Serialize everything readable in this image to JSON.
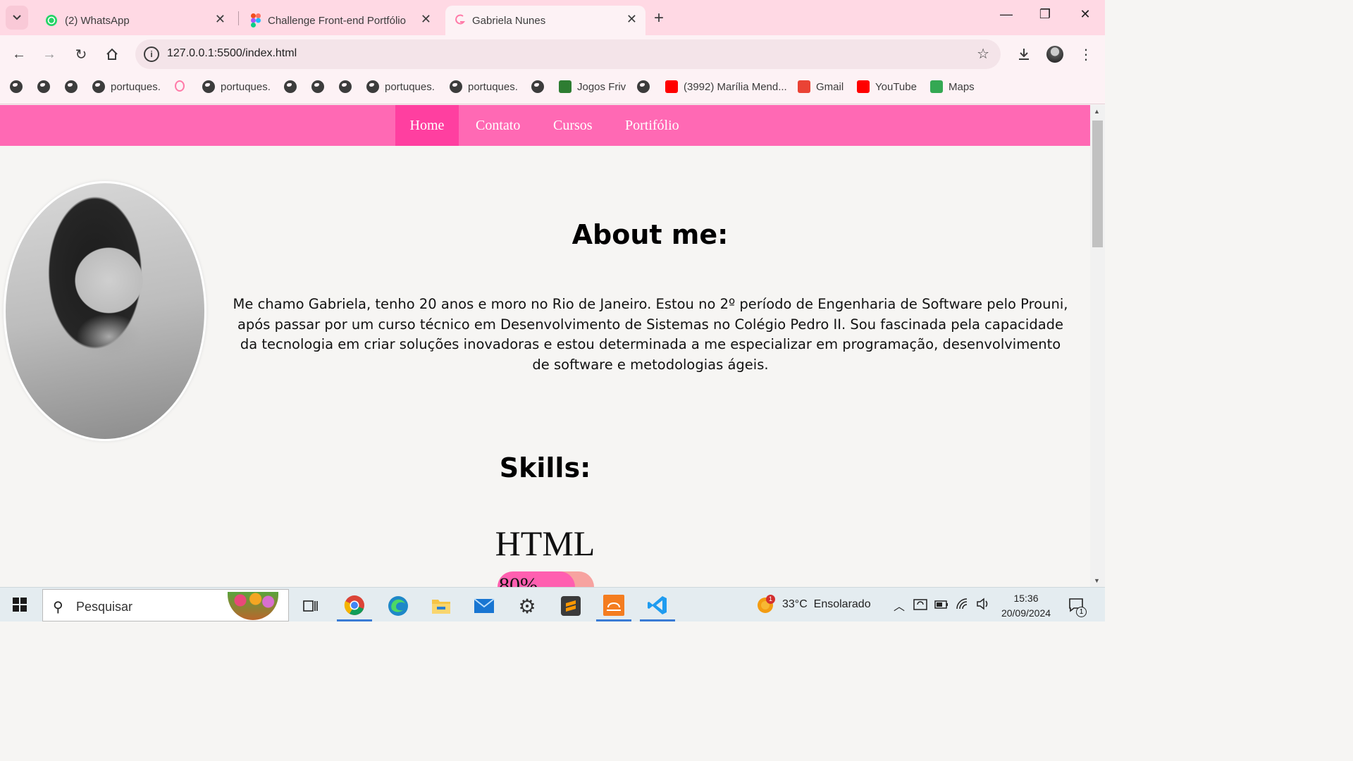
{
  "browser": {
    "tabs": [
      {
        "label": "(2) WhatsApp",
        "icon": "whatsapp-icon",
        "active": false
      },
      {
        "label": "Challenge Front-end Portfólio -",
        "icon": "figma-icon",
        "active": false
      },
      {
        "label": "Gabriela Nunes",
        "icon": "site-g-icon",
        "active": true
      }
    ],
    "address": "127.0.0.1:5500/index.html",
    "bookmarks": [
      {
        "label": "",
        "icon": "globe-icon"
      },
      {
        "label": "",
        "icon": "globe-icon"
      },
      {
        "label": "",
        "icon": "globe-icon"
      },
      {
        "label": "portuques.",
        "icon": "globe-icon"
      },
      {
        "label": "",
        "icon": "site-g-icon"
      },
      {
        "label": "portuques.",
        "icon": "globe-icon"
      },
      {
        "label": "",
        "icon": "globe-icon"
      },
      {
        "label": "",
        "icon": "globe-icon"
      },
      {
        "label": "",
        "icon": "globe-icon"
      },
      {
        "label": "portuques.",
        "icon": "globe-icon"
      },
      {
        "label": "portuques.",
        "icon": "globe-icon"
      },
      {
        "label": "",
        "icon": "globe-icon"
      },
      {
        "label": "Jogos Friv",
        "icon": "friv-icon"
      },
      {
        "label": "",
        "icon": "globe-icon"
      },
      {
        "label": "(3992) Marília Mend...",
        "icon": "youtube-icon"
      },
      {
        "label": "Gmail",
        "icon": "gmail-icon"
      },
      {
        "label": "YouTube",
        "icon": "youtube-icon"
      },
      {
        "label": "Maps",
        "icon": "maps-icon"
      }
    ]
  },
  "site": {
    "nav": [
      "Home",
      "Contato",
      "Cursos",
      "Portifólio"
    ],
    "about_title": "About me:",
    "about_text": "Me chamo Gabriela, tenho 20 anos e moro no Rio de Janeiro. Estou no 2º período de Engenharia de Software pelo Prouni, após passar por um curso técnico em Desenvolvimento de Sistemas no Colégio Pedro II. Sou fascinada pela capacidade da tecnologia em criar soluções inovadoras e estou determinada a me especializar em programação, desenvolvimento de software e metodologias ágeis.",
    "skills_title": "Skills:",
    "skills": [
      {
        "name": "HTML",
        "percent_label": "80%",
        "level": 0.8
      }
    ],
    "colors": {
      "nav": "#ff69b4",
      "nav_active": "#ff3fa0",
      "bar_fill": "#ff5fb0",
      "bar_track": "#f7a3a0"
    }
  },
  "taskbar": {
    "search_placeholder": "Pesquisar",
    "weather": "33°C  Ensolarado",
    "weather_badge": "1",
    "time": "15:36",
    "date": "20/09/2024",
    "notification_count": "1",
    "apps": [
      "task-view-icon",
      "chrome-icon",
      "edge-icon",
      "file-explorer-icon",
      "mail-icon",
      "settings-icon",
      "sublime-text-icon",
      "app-orange-icon",
      "vscode-icon"
    ]
  }
}
